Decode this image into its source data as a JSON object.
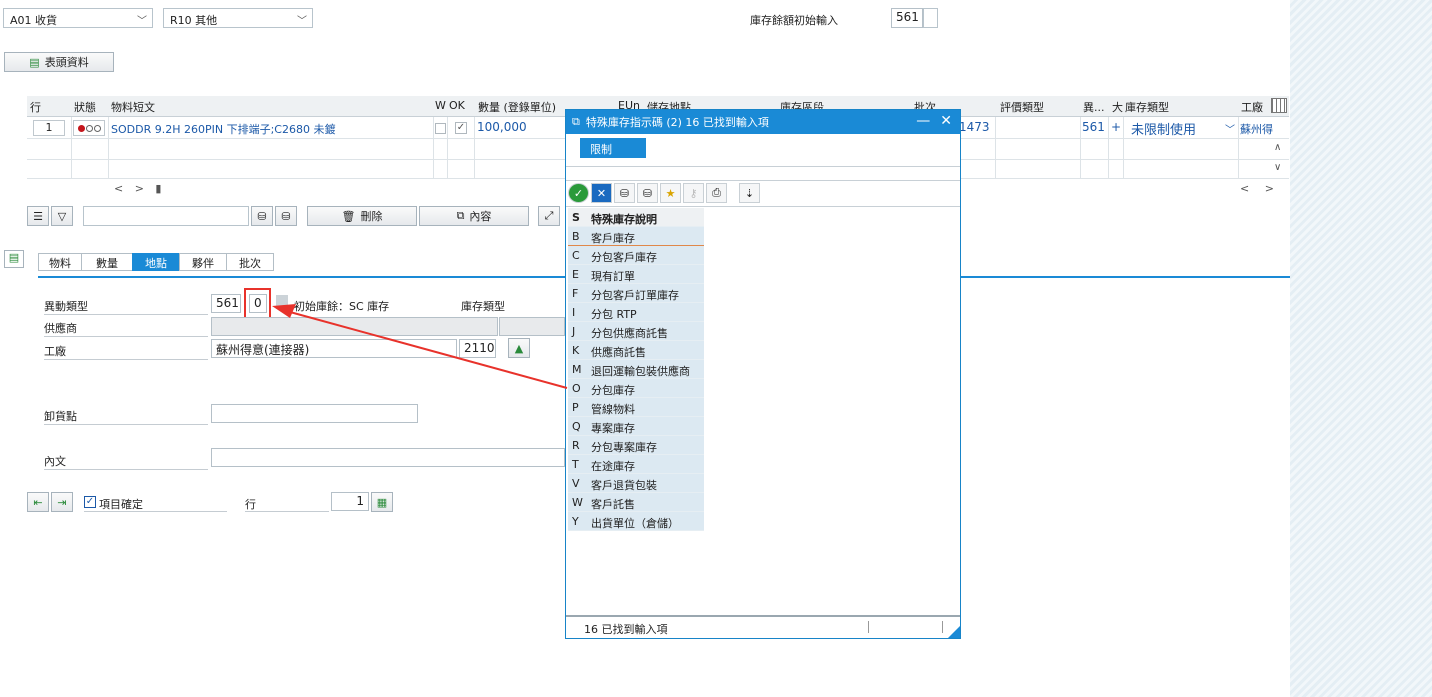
{
  "top": {
    "movement_select": "A01 收貨",
    "reference_select": "R10 其他",
    "stock_init_label": "庫存餘額初始輸入",
    "stock_init_value": "561",
    "header_button": "表頭資料"
  },
  "grid": {
    "headers": [
      "行",
      "狀態",
      "物料短文",
      "W",
      "OK",
      "數量 (登錄單位)",
      "EUn",
      "儲存地點",
      "庫存區段",
      "批次",
      "評價類型",
      "異...",
      "大",
      "庫存類型",
      "工廠"
    ],
    "row": {
      "line": "1",
      "material": "SODDR 9.2H 260PIN 下排端子;C2680 未鍍",
      "qty": "100,000",
      "batch_partial": "1473",
      "mvt": "561",
      "sign": "+",
      "stock_type": "未限制使用",
      "plant": "蘇州得"
    },
    "nav": "< > ▮",
    "right_nav": "< >"
  },
  "actions": {
    "delete": "刪除",
    "content": "內容"
  },
  "tabs": [
    "物料",
    "數量",
    "地點",
    "夥伴",
    "批次"
  ],
  "detail": {
    "mvt_type_label": "異動類型",
    "mvt_type": "561",
    "special_stock": "0",
    "special_stock_desc": "初始庫餘：SC 庫存",
    "stock_type_label": "庫存類型",
    "vendor_label": "供應商",
    "plant_label": "工廠",
    "plant_name": "蘇州得意(連接器)",
    "plant_code": "2110",
    "unload_label": "卸貨點",
    "text_label": "內文",
    "item_ok": "項目確定",
    "line_label": "行",
    "line_value": "1"
  },
  "popup": {
    "title": "特殊庫存指示碼 (2)  16 已找到輸入項",
    "restrict": "限制",
    "col_key": "S",
    "col_desc": "特殊庫存說明",
    "items": [
      {
        "k": "B",
        "d": "客戶庫存"
      },
      {
        "k": "C",
        "d": "分包客戶庫存"
      },
      {
        "k": "E",
        "d": "現有訂單"
      },
      {
        "k": "F",
        "d": "分包客戶訂單庫存"
      },
      {
        "k": "I",
        "d": "分包 RTP"
      },
      {
        "k": "J",
        "d": "分包供應商託售"
      },
      {
        "k": "K",
        "d": "供應商託售"
      },
      {
        "k": "M",
        "d": "退回運輸包裝供應商"
      },
      {
        "k": "O",
        "d": "分包庫存"
      },
      {
        "k": "P",
        "d": "管線物料"
      },
      {
        "k": "Q",
        "d": "專案庫存"
      },
      {
        "k": "R",
        "d": "分包專案庫存"
      },
      {
        "k": "T",
        "d": "在途庫存"
      },
      {
        "k": "V",
        "d": "客戶退貨包裝"
      },
      {
        "k": "W",
        "d": "客戶託售"
      },
      {
        "k": "Y",
        "d": "出貨單位（倉儲）"
      }
    ],
    "footer": "16 已找到輸入項"
  },
  "colors": {
    "accent": "#1a8ad6",
    "annotation": "#e8322b"
  }
}
